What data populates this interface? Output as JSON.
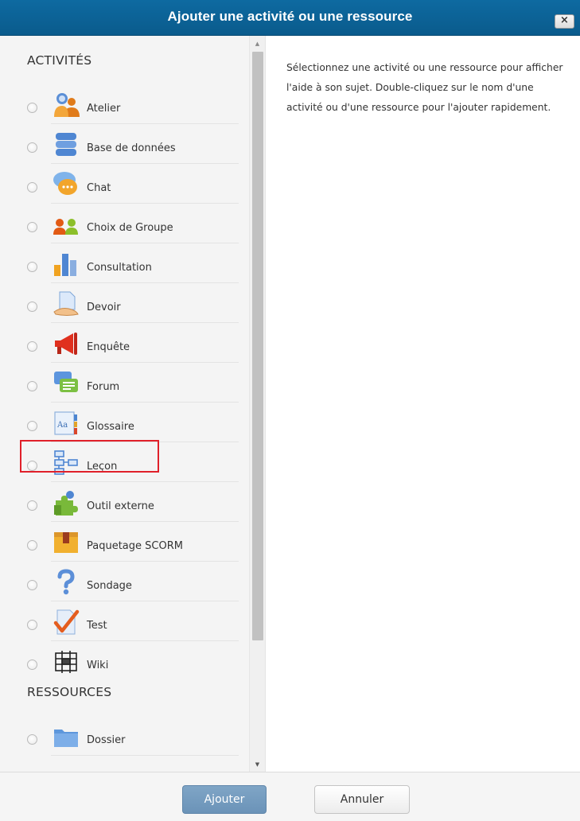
{
  "dialog": {
    "title": "Ajouter une activité ou une ressource",
    "close_label": "×"
  },
  "sections": {
    "activities_label": "ACTIVITÉS",
    "resources_label": "RESSOURCES"
  },
  "activities": [
    {
      "label": "Atelier",
      "icon": "workshop-icon"
    },
    {
      "label": "Base de données",
      "icon": "database-icon"
    },
    {
      "label": "Chat",
      "icon": "chat-icon"
    },
    {
      "label": "Choix de Groupe",
      "icon": "group-choice-icon"
    },
    {
      "label": "Consultation",
      "icon": "feedback-chart-icon"
    },
    {
      "label": "Devoir",
      "icon": "assignment-icon"
    },
    {
      "label": "Enquête",
      "icon": "survey-megaphone-icon"
    },
    {
      "label": "Forum",
      "icon": "forum-icon"
    },
    {
      "label": "Glossaire",
      "icon": "glossary-icon",
      "highlighted": true
    },
    {
      "label": "Leçon",
      "icon": "lesson-icon"
    },
    {
      "label": "Outil externe",
      "icon": "puzzle-icon"
    },
    {
      "label": "Paquetage SCORM",
      "icon": "package-icon"
    },
    {
      "label": "Sondage",
      "icon": "question-icon"
    },
    {
      "label": "Test",
      "icon": "quiz-check-icon"
    },
    {
      "label": "Wiki",
      "icon": "wiki-icon"
    }
  ],
  "resources": [
    {
      "label": "Dossier",
      "icon": "folder-icon"
    }
  ],
  "help": {
    "text": "Sélectionnez une activité ou une ressource pour afficher l'aide à son sujet. Double-cliquez sur le nom d'une activité ou d'une ressource pour l'ajouter rapidement."
  },
  "footer": {
    "submit_label": "Ajouter",
    "cancel_label": "Annuler"
  },
  "colors": {
    "titlebar": "#0e6aa1",
    "submit_button": "#7fa5c6",
    "highlight_border": "#e0202a"
  }
}
